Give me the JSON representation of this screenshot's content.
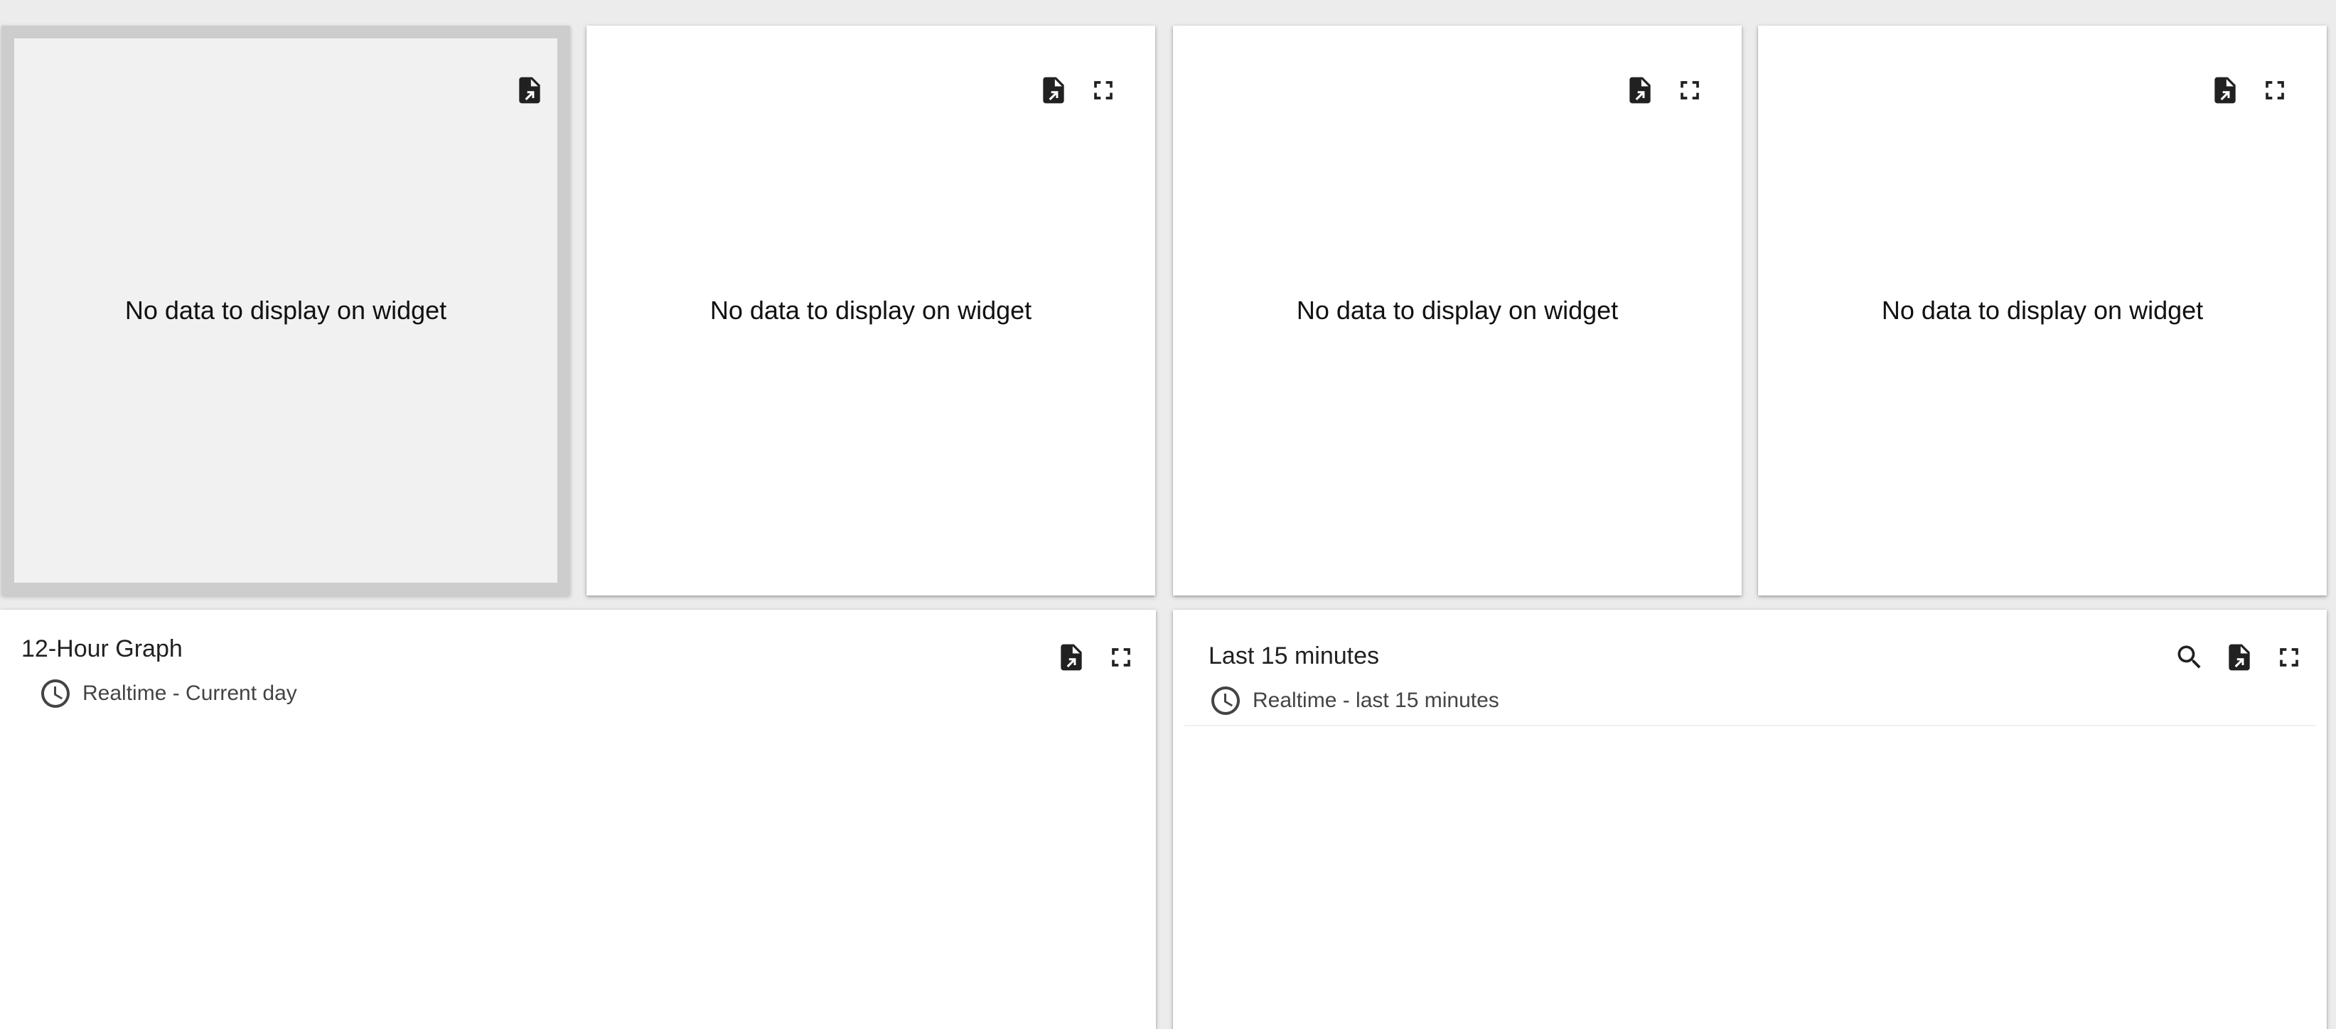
{
  "widgets": [
    {
      "no_data_text": "No data to display on widget"
    },
    {
      "no_data_text": "No data to display on widget"
    },
    {
      "no_data_text": "No data to display on widget"
    },
    {
      "no_data_text": "No data to display on widget"
    },
    {
      "title": "12-Hour Graph",
      "timewindow": "Realtime - Current day"
    },
    {
      "title": "Last 15 minutes",
      "timewindow": "Realtime - last 15 minutes"
    }
  ],
  "icons": {
    "export": "file-export-icon",
    "fullscreen": "fullscreen-icon",
    "search": "search-icon",
    "timewindow": "clock-icon"
  },
  "colors": {
    "background": "#ececec",
    "widget_background": "#ffffff",
    "selected_widget_background": "#f1f1f1",
    "selected_widget_border": "#cdcdcd",
    "icon": "#212121"
  }
}
